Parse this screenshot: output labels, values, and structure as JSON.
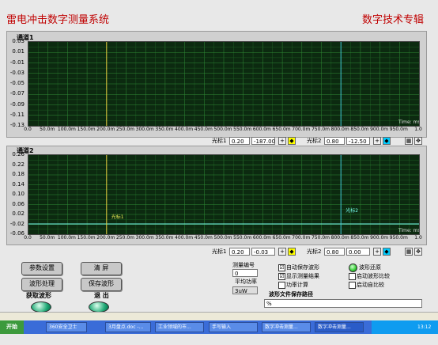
{
  "header": {
    "title": "雷电冲击数字测量系统",
    "subtitle": "数字技术专辑"
  },
  "channel1": {
    "name": "通道1",
    "y_ticks": [
      "0.03",
      "0.01",
      "-0.01",
      "-0.03",
      "-0.05",
      "-0.07",
      "-0.09",
      "-0.11",
      "-0.13"
    ],
    "x_unit": "Time: ms",
    "cursor1_label": "光标1",
    "cursor1_pos": "0.20",
    "cursor1_val": "-187.00",
    "cursor2_label": "光标2",
    "cursor2_pos": "0.80",
    "cursor2_val": "-12.50"
  },
  "channel2": {
    "name": "通道2",
    "y_ticks": [
      "0.26",
      "0.22",
      "0.18",
      "0.14",
      "0.10",
      "0.06",
      "0.02",
      "-0.02",
      "-0.06"
    ],
    "x_unit": "Time: ms",
    "cursor1_label": "光标1",
    "cursor1_pos": "0.20",
    "cursor1_val": "-0.03",
    "cursor2_label": "光标2",
    "cursor2_pos": "0.80",
    "cursor2_val": "0.00"
  },
  "x_ticks": [
    "0.0",
    "50.0m",
    "100.0m",
    "150.0m",
    "200.0m",
    "250.0m",
    "300.0m",
    "350.0m",
    "400.0m",
    "450.0m",
    "500.0m",
    "550.0m",
    "600.0m",
    "650.0m",
    "700.0m",
    "750.0m",
    "800.0m",
    "850.0m",
    "900.0m",
    "950.0m",
    "1.0"
  ],
  "buttons": {
    "param": "参数设置",
    "clear": "清 屏",
    "process": "波形处理",
    "save": "保存波形",
    "acquire": "获取波形",
    "exit": "退 出"
  },
  "measure": {
    "num_label": "测量编号",
    "num_value": "0",
    "avg_label": "平均功率",
    "avg_value": "3uW"
  },
  "options": {
    "auto_save": "自动保存波形",
    "show_result": "显示测量结果",
    "power_calc": "功率计算",
    "restore": "波形还原",
    "start_compare": "启动波形比较",
    "start_self": "启动自比较",
    "auto_save_checked": "☑",
    "show_result_checked": "☑"
  },
  "path": {
    "label": "波形文件保存路径",
    "value": "%"
  },
  "taskbar": {
    "start": "开始",
    "items": [
      "360安全卫士",
      "3月盘点.doc -...",
      "工业领域的市...",
      "手写输入",
      "数字冲击测量...",
      "数字冲击测量..."
    ],
    "time": "13:12"
  }
}
